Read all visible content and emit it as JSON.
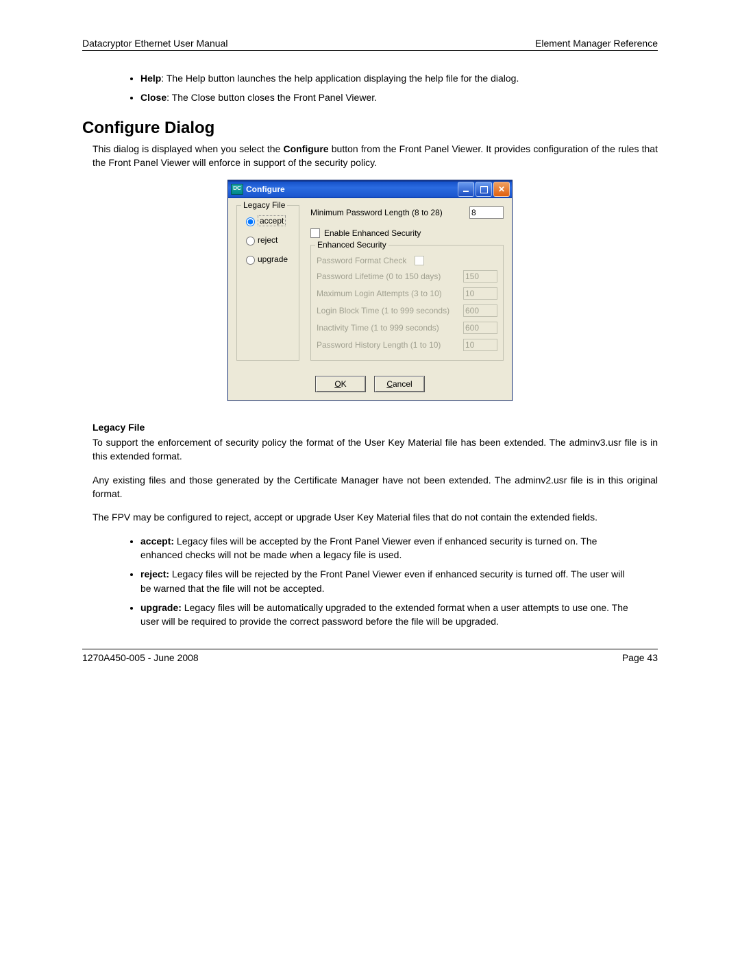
{
  "header": {
    "left": "Datacryptor Ethernet User Manual",
    "right": "Element Manager Reference"
  },
  "footer": {
    "left": "1270A450-005 - June 2008",
    "right": "Page 43"
  },
  "intro_bullets": [
    {
      "label": "Help",
      "text": ": The Help button launches the help application displaying the help file for the dialog."
    },
    {
      "label": "Close",
      "text": ": The Close button closes the Front Panel Viewer."
    }
  ],
  "section_title": "Configure Dialog",
  "section_intro_a": "This dialog is displayed when you select the ",
  "section_intro_bold": "Configure",
  "section_intro_b": " button from the Front Panel Viewer. It provides configuration of the rules that the Front Panel Viewer will enforce in support of the security policy.",
  "dialog": {
    "title": "Configure",
    "legacy_legend": "Legacy File",
    "legacy_opts": {
      "accept": "accept",
      "reject": "reject",
      "upgrade": "upgrade"
    },
    "min_pwd_label": "Minimum Password Length (8 to 28)",
    "min_pwd_value": "8",
    "enable_es_label": "Enable Enhanced Security",
    "es_legend": "Enhanced Security",
    "es_rows": {
      "fmt": "Password Format Check",
      "life_label": "Password Lifetime (0 to 150 days)",
      "life_val": "150",
      "max_label": "Maximum Login Attempts (3 to 10)",
      "max_val": "10",
      "block_label": "Login Block Time (1 to 999 seconds)",
      "block_val": "600",
      "inact_label": "Inactivity Time (1 to 999 seconds)",
      "inact_val": "600",
      "hist_label": "Password History Length (1 to 10)",
      "hist_val": "10"
    },
    "ok": "OK",
    "ok_u": "O",
    "ok_rest": "K",
    "cancel": "Cancel",
    "cancel_u": "C",
    "cancel_rest": "ancel"
  },
  "legacy_section": {
    "title": "Legacy File",
    "p1": "To support the enforcement of security policy the format of the User Key Material file has been extended.  The adminv3.usr file is in this extended format.",
    "p2": "Any existing files and those generated by the Certificate Manager have not been extended.  The adminv2.usr file is in this original format.",
    "p3": "The FPV may be configured to reject, accept or upgrade User Key Material files that do not contain the extended fields.",
    "bullets": [
      {
        "label": "accept:",
        "text": "  Legacy files will be accepted by the Front Panel Viewer even if enhanced security is turned on.  The enhanced checks will not be made when a legacy file is used."
      },
      {
        "label": "reject:",
        "text": "  Legacy files will be rejected by the Front Panel Viewer even if enhanced security is turned off.  The user will be warned that the file will not be accepted."
      },
      {
        "label": "upgrade:",
        "text": "  Legacy files will be automatically upgraded to the extended format when a user attempts to use one.  The user will be required to provide the correct password before the file will be upgraded."
      }
    ]
  }
}
